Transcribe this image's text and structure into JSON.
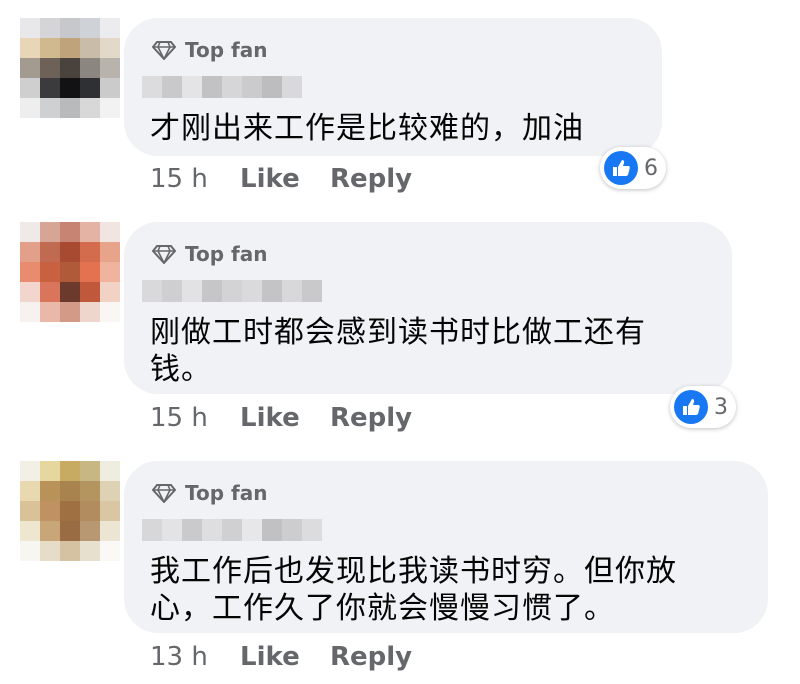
{
  "comments": [
    {
      "badge": "Top fan",
      "text_lines": [
        "才刚出来工作是比较难的，加油"
      ],
      "time": "15 h",
      "like": "Like",
      "reply": "Reply",
      "reactions": "6",
      "avatar": [
        "#e8e8ea",
        "#d5d5d8",
        "#c6c8cb",
        "#cfd2d6",
        "#ececee",
        "#e9d6b9",
        "#d0b88f",
        "#bfa37a",
        "#c9bda9",
        "#e3d9c8",
        "#a39a90",
        "#6e6258",
        "#4a423c",
        "#8b8680",
        "#b8b3ac",
        "#cfcfcf",
        "#3b3b3d",
        "#121214",
        "#2f3033",
        "#cbcbcb",
        "#eeeeee",
        "#cfd0d2",
        "#b9babc",
        "#d8d8d9",
        "#f2f2f2"
      ]
    },
    {
      "badge": "Top fan",
      "text_lines": [
        "刚做工时都会感到读书时比做工还有",
        "钱。"
      ],
      "time": "15 h",
      "like": "Like",
      "reply": "Reply",
      "reactions": "3",
      "avatar": [
        "#efe9e8",
        "#d7a596",
        "#c78473",
        "#e5b3a3",
        "#f0e5e0",
        "#e2a08b",
        "#c06a52",
        "#a84a32",
        "#d36c4d",
        "#e8a48a",
        "#e98b6f",
        "#c9603f",
        "#b05a3a",
        "#e47150",
        "#f0b49e",
        "#f2d6cd",
        "#d9755a",
        "#6b3a2c",
        "#c0593c",
        "#f3d2c6",
        "#f7f2f0",
        "#eab8a8",
        "#d39a88",
        "#efd6cd",
        "#faf6f4"
      ]
    },
    {
      "badge": "Top fan",
      "text_lines": [
        "我工作后也发现比我读书时穷。但你放",
        "心，工作久了你就会慢慢习惯了。"
      ],
      "time": "13 h",
      "like": "Like",
      "reply": "Reply",
      "reactions": "",
      "avatar": [
        "#f1efe6",
        "#e6d79e",
        "#c7ab62",
        "#c7b783",
        "#efece0",
        "#e8d9b0",
        "#b9925a",
        "#a8834e",
        "#b5955f",
        "#ddd2b4",
        "#d9c298",
        "#c09261",
        "#9f7142",
        "#b28c5e",
        "#d8c7a2",
        "#efe6cf",
        "#c8a678",
        "#996c43",
        "#b89872",
        "#ede5d3",
        "#f8f6f0",
        "#e6dcc8",
        "#d4c2a3",
        "#e8e0cf",
        "#faf9f5"
      ]
    }
  ]
}
